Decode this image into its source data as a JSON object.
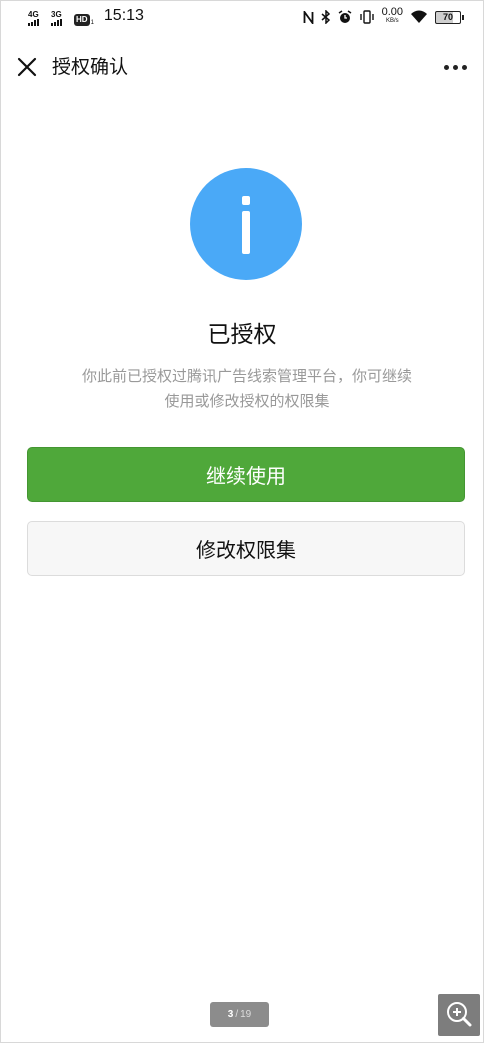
{
  "status_bar": {
    "network_1": "4G",
    "network_2": "3G",
    "hd_badge": "HD",
    "hd_sub": "1",
    "time": "15:13",
    "speed_value": "0.00",
    "speed_unit": "KB/s",
    "battery_level": "70",
    "icons": [
      "nfc-icon",
      "bluetooth-icon",
      "alarm-icon",
      "vibrate-icon",
      "wifi-icon",
      "battery-icon"
    ]
  },
  "nav": {
    "title": "授权确认",
    "close_icon": "close-icon",
    "more_icon": "more-icon"
  },
  "content": {
    "icon": "info-icon",
    "icon_color": "#4aa9f7",
    "title": "已授权",
    "description_line1": "你此前已授权过腾讯广告线索管理平台，你可继续",
    "description_line2": "使用或修改授权的权限集"
  },
  "buttons": {
    "continue_label": "继续使用",
    "continue_color": "#4fa83a",
    "modify_label": "修改权限集"
  },
  "pager": {
    "current": "3",
    "separator": "/",
    "total": "19",
    "zoom_icon": "zoom-in-icon"
  }
}
